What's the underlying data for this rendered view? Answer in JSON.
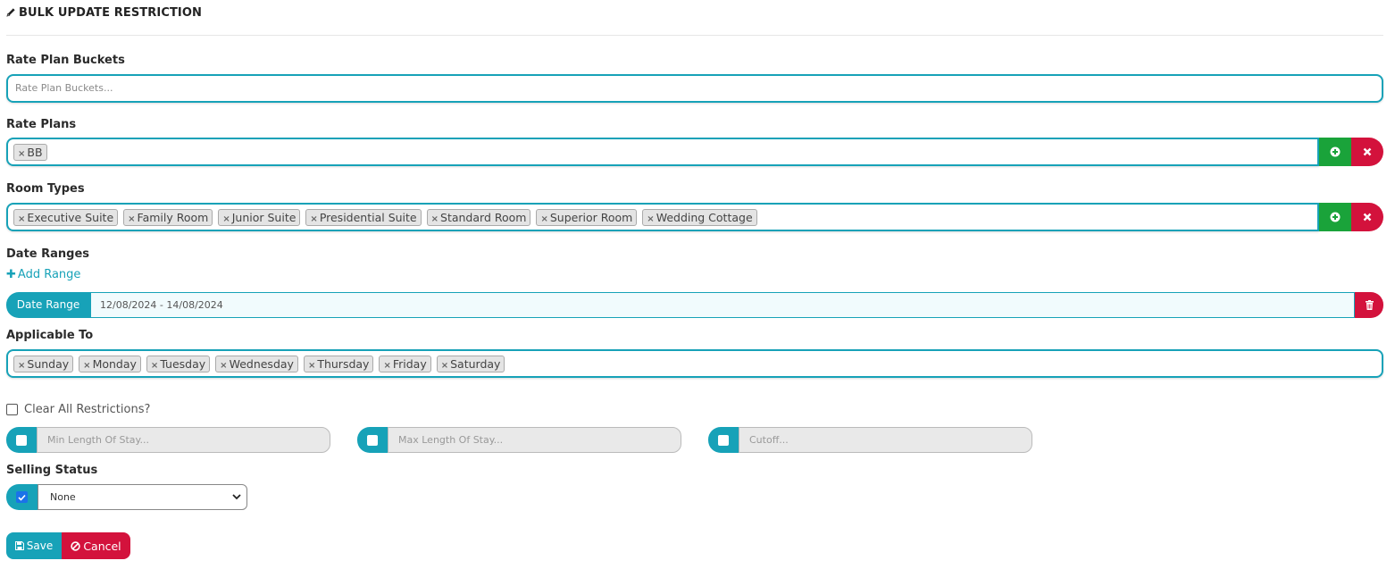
{
  "header": {
    "title": "BULK UPDATE RESTRICTION",
    "icon": "pencil-icon"
  },
  "rate_plan_buckets": {
    "label": "Rate Plan Buckets",
    "placeholder": "Rate Plan Buckets..."
  },
  "rate_plans": {
    "label": "Rate Plans",
    "tags": [
      "BB"
    ]
  },
  "room_types": {
    "label": "Room Types",
    "tags": [
      "Executive Suite",
      "Family Room",
      "Junior Suite",
      "Presidential Suite",
      "Standard Room",
      "Superior Room",
      "Wedding Cottage"
    ]
  },
  "date_ranges": {
    "label": "Date Ranges",
    "add_label": "Add Range",
    "range_label": "Date Range",
    "range_value": "12/08/2024 - 14/08/2024"
  },
  "applicable_to": {
    "label": "Applicable To",
    "tags": [
      "Sunday",
      "Monday",
      "Tuesday",
      "Wednesday",
      "Thursday",
      "Friday",
      "Saturday"
    ]
  },
  "clear_all": {
    "label": "Clear All Restrictions?",
    "checked": false
  },
  "restrictions": {
    "min_los": "Min Length Of Stay...",
    "max_los": "Max Length Of Stay...",
    "cutoff": "Cutoff..."
  },
  "selling_status": {
    "label": "Selling Status",
    "value": "None",
    "checked": true
  },
  "actions": {
    "save": "Save",
    "cancel": "Cancel"
  },
  "colors": {
    "accent": "#17a2b8",
    "success": "#1aa33a",
    "danger": "#d3123c"
  }
}
